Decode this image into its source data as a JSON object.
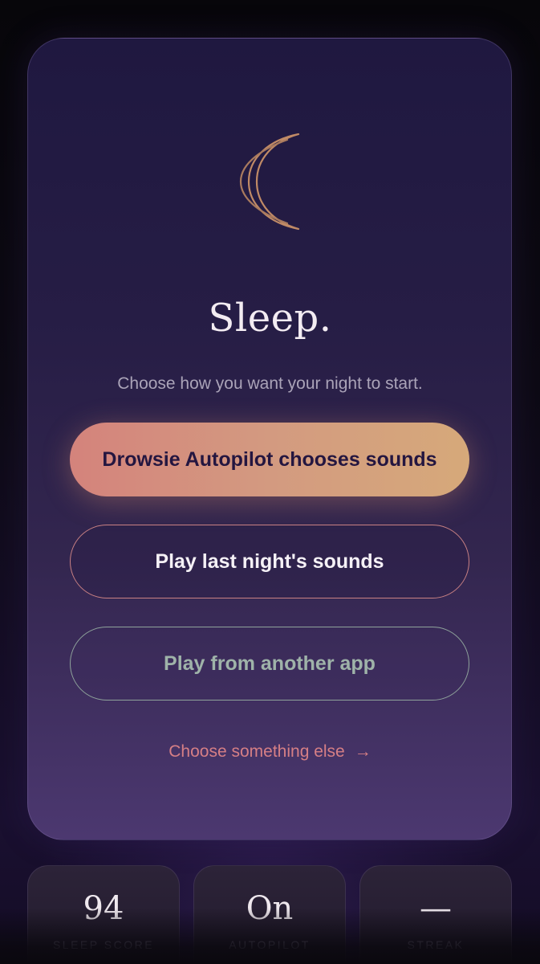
{
  "main": {
    "icon": "crescent-moon-icon",
    "title": "Sleep.",
    "subtitle": "Choose how you want your night to start.",
    "buttons": {
      "autopilot": "Drowsie Autopilot chooses sounds",
      "last_night": "Play last night's sounds",
      "another_app": "Play from another app"
    },
    "link": {
      "label": "Choose something else",
      "arrow": "→"
    }
  },
  "stats": [
    {
      "value": "94",
      "label": "SLEEP SCORE"
    },
    {
      "value": "On",
      "label": "AUTOPILOT"
    },
    {
      "value": "—",
      "label": "STREAK"
    }
  ],
  "colors": {
    "accent_primary": "#d4837c",
    "accent_primary_end": "#d6a97a",
    "outline_rose": "#c98183",
    "outline_sage": "#8fa39b",
    "link": "#d67f85",
    "moon": "#c08a66"
  }
}
